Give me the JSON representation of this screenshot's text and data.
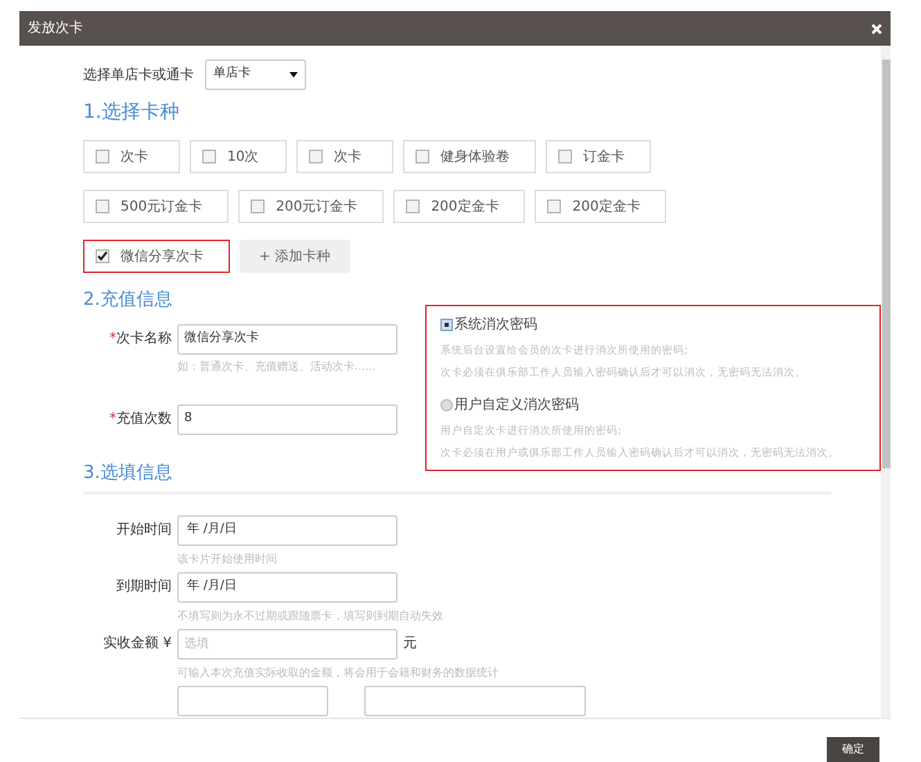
{
  "window": {
    "title": "发放次卡"
  },
  "card_scope": {
    "label": "选择单店卡或通卡",
    "value": "单店卡"
  },
  "section_1": {
    "heading": "1.选择卡种",
    "groups": [
      {
        "options": [
          {
            "label": "次卡",
            "checked": false,
            "highlighted": false
          },
          {
            "label": "10次",
            "checked": false,
            "highlighted": false
          },
          {
            "label": "次卡",
            "checked": false,
            "highlighted": false
          },
          {
            "label": "健身体验卷",
            "checked": false,
            "highlighted": false
          },
          {
            "label": "订金卡",
            "checked": false,
            "highlighted": false
          }
        ]
      },
      {
        "options": [
          {
            "label": "500元订金卡",
            "checked": false,
            "highlighted": false
          },
          {
            "label": "200元订金卡",
            "checked": false,
            "highlighted": false
          },
          {
            "label": "200定金卡",
            "checked": false,
            "highlighted": false
          },
          {
            "label": "200定金卡",
            "checked": false,
            "highlighted": false
          }
        ]
      },
      {
        "options": [
          {
            "label": "微信分享次卡",
            "checked": true,
            "highlighted": true
          }
        ]
      }
    ],
    "add_button": "+ 添加卡种"
  },
  "section_2": {
    "heading": "2.充值信息",
    "fields": [
      {
        "label": "次卡名称",
        "required_mark": "*",
        "value": "微信分享次卡",
        "hint": "如：普通次卡、充值赠送、活动次卡......"
      },
      {
        "label": "充值次数",
        "required_mark": "*",
        "value": "8"
      }
    ],
    "password_box": {
      "highlighted": true,
      "options": [
        {
          "label": "系统消次密码",
          "selected": true,
          "lines": [
            "系统后台设置给会员的次卡进行消次所使用的密码;",
            "次卡必须在俱乐部工作人员输入密码确认后才可以消次，无密码无法消次。"
          ]
        },
        {
          "label": "用户自定义消次密码",
          "selected": false,
          "lines": [
            "用户自定次卡进行消次所使用的密码;",
            "次卡必须在用户或俱乐部工作人员输入密码确认后才可以消次，无密码无法消次。"
          ]
        }
      ]
    }
  },
  "section_3": {
    "heading": "3.选填信息",
    "fields": [
      {
        "kind": "date",
        "label": "开始时间",
        "value": "年 /月/日",
        "hint": "该卡片开始使用时间"
      },
      {
        "kind": "date",
        "label": "到期时间",
        "value": "年 /月/日",
        "hint": "不填写则为永不过期或跟随票卡，填写则到期自动失效"
      },
      {
        "kind": "amount",
        "label": "实收金额 ¥",
        "placeholder": "选填",
        "unit": "元",
        "hint": "可输入本次充值实际收取的金额，将会用于会籍和财务的数据统计"
      },
      {
        "kind": "select_or_input"
      }
    ]
  },
  "footer": {
    "confirm_button": "确定"
  }
}
